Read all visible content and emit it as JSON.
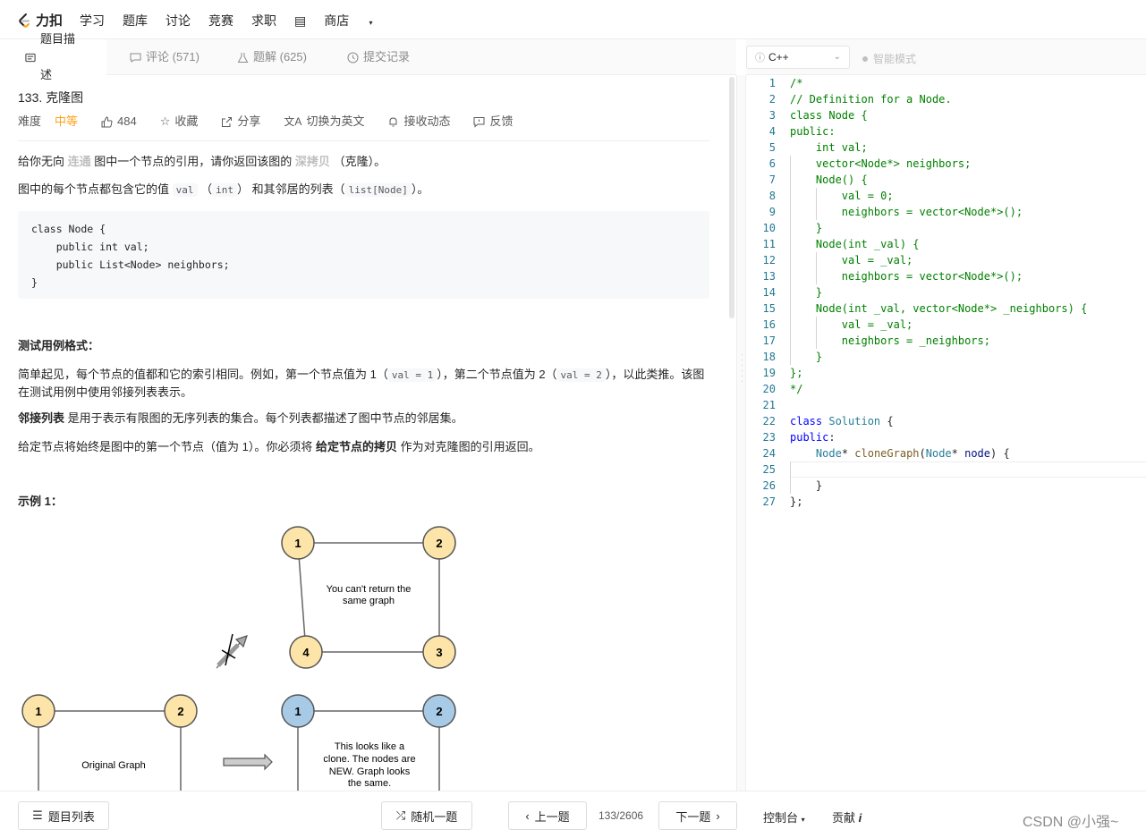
{
  "nav": {
    "logo": "力扣",
    "links": [
      "学习",
      "题库",
      "讨论",
      "竞赛",
      "求职"
    ],
    "store": "商店"
  },
  "tabs": {
    "description": "题目描述",
    "comments": "评论 (571)",
    "solutions": "题解 (625)",
    "submissions": "提交记录"
  },
  "editor_bar": {
    "language": "C++",
    "smart_mode": "智能模式"
  },
  "problem": {
    "title": "133. 克隆图",
    "difficulty_label": "难度",
    "difficulty": "中等",
    "likes": "484",
    "favorite": "收藏",
    "share": "分享",
    "switch_lang": "切换为英文",
    "notify": "接收动态",
    "feedback": "反馈"
  },
  "body": {
    "p1_a": "给你无向",
    "p1_hl1": "连通",
    "p1_b": "图中一个节点的引用，请你返回该图的",
    "p1_hl2": "深拷贝",
    "p1_c": "（克隆）。",
    "p2_a": "图中的每个节点都包含它的值",
    "p2_val": "val",
    "p2_int": "int",
    "p2_b": "和其邻居的列表（",
    "p2_list": "list[Node]",
    "p2_c": "）。",
    "code": "class Node {\n    public int val;\n    public List<Node> neighbors;\n}",
    "test_heading": "测试用例格式：",
    "p3_a": "简单起见，每个节点的值都和它的索引相同。例如，第一个节点值为 1（",
    "p3_c1": "val = 1",
    "p3_b": "），第二个节点值为 2（",
    "p3_c2": "val = 2",
    "p3_c": "），以此类推。该图在测试用例中使用邻接列表表示。",
    "p4_bold": "邻接列表",
    "p4_rest": "是用于表示有限图的无序列表的集合。每个列表都描述了图中节点的邻居集。",
    "p5_a": "给定节点将始终是图中的第一个节点（值为 1）。你必须将",
    "p5_bold": "给定节点的拷贝",
    "p5_b": "作为对克隆图的引用返回。",
    "example_heading": "示例 1："
  },
  "diagram": {
    "top_nodes": [
      "1",
      "2",
      "3",
      "4"
    ],
    "top_caption_1": "You can't return the",
    "top_caption_2": "same graph",
    "orig_nodes": [
      "1",
      "2"
    ],
    "orig_caption": "Original Graph",
    "clone_nodes": [
      "1",
      "2"
    ],
    "clone_caption_1": "This looks like a",
    "clone_caption_2": "clone. The nodes are",
    "clone_caption_3": "NEW. Graph looks",
    "clone_caption_4": "the same.",
    "colors": {
      "yellow": "#fde4a8",
      "blue": "#a7cbe6"
    }
  },
  "code_lines": [
    {
      "n": "1",
      "t": "/*"
    },
    {
      "n": "2",
      "t": "// Definition for a Node."
    },
    {
      "n": "3",
      "t": "class Node {"
    },
    {
      "n": "4",
      "t": "public:"
    },
    {
      "n": "5",
      "t": "    int val;"
    },
    {
      "n": "6",
      "t": "    vector<Node*> neighbors;"
    },
    {
      "n": "7",
      "t": "    Node() {"
    },
    {
      "n": "8",
      "t": "        val = 0;"
    },
    {
      "n": "9",
      "t": "        neighbors = vector<Node*>();"
    },
    {
      "n": "10",
      "t": "    }"
    },
    {
      "n": "11",
      "t": "    Node(int _val) {"
    },
    {
      "n": "12",
      "t": "        val = _val;"
    },
    {
      "n": "13",
      "t": "        neighbors = vector<Node*>();"
    },
    {
      "n": "14",
      "t": "    }"
    },
    {
      "n": "15",
      "t": "    Node(int _val, vector<Node*> _neighbors) {"
    },
    {
      "n": "16",
      "t": "        val = _val;"
    },
    {
      "n": "17",
      "t": "        neighbors = _neighbors;"
    },
    {
      "n": "18",
      "t": "    }"
    },
    {
      "n": "19",
      "t": "};"
    },
    {
      "n": "20",
      "t": "*/"
    },
    {
      "n": "21",
      "t": ""
    },
    {
      "n": "22",
      "t": "class Solution {"
    },
    {
      "n": "23",
      "t": "public:"
    },
    {
      "n": "24",
      "t": "    Node* cloneGraph(Node* node) {"
    },
    {
      "n": "25",
      "t": ""
    },
    {
      "n": "26",
      "t": "    }"
    },
    {
      "n": "27",
      "t": "};"
    }
  ],
  "bottom": {
    "problem_list": "题目列表",
    "random": "随机一题",
    "prev": "上一题",
    "page": "133/2606",
    "next": "下一题",
    "console": "控制台",
    "contribute": "贡献",
    "contribute_icon": "i"
  },
  "watermark": "CSDN @小强~"
}
